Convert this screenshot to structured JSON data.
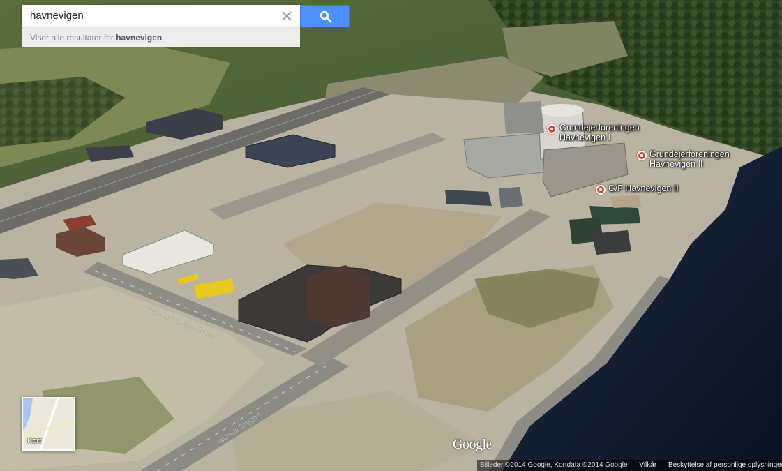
{
  "search": {
    "value": "havnevigen",
    "placeholder": "",
    "results_prefix": "Viser alle resultater for",
    "results_query": "havnevigen"
  },
  "places": [
    {
      "name": "Grundejerforeningen\nHavnevigen I"
    },
    {
      "name": "Grundejerforeningen\nHavnevigen II"
    },
    {
      "name": "G/F Havnevigen II"
    }
  ],
  "streets": [
    {
      "name": "Thorvald Borgs Gade"
    },
    {
      "name": "Islands Brygge"
    }
  ],
  "map_type": {
    "label": "Kort"
  },
  "logo": "Google",
  "attribution": {
    "imagery": "Billeder ©2014 Google, Kortdata ©2014 Google",
    "terms": "Vilkår",
    "privacy": "Beskyttelse af personlige oplysninger"
  },
  "colors": {
    "water": "#0f1a2e",
    "pin": "#e23d2e",
    "search_button": "#4d90fe"
  },
  "icons": {
    "search": "search-icon",
    "clear": "close-icon",
    "place": "place-pin-icon"
  }
}
